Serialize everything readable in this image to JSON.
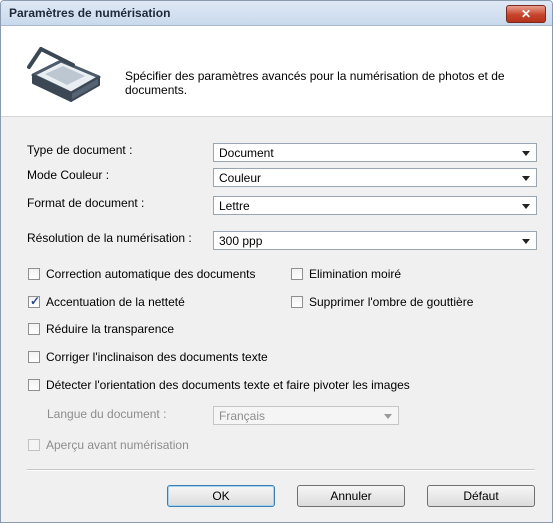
{
  "window": {
    "title": "Paramètres de numérisation",
    "close_label": "✕"
  },
  "header": {
    "description": "Spécifier des paramètres avancés pour la numérisation de photos et de documents.",
    "icon": "scanner-icon"
  },
  "fields": {
    "document_type": {
      "label": "Type de document :",
      "value": "Document"
    },
    "color_mode": {
      "label": "Mode Couleur :",
      "value": "Couleur"
    },
    "document_size": {
      "label": "Format de document :",
      "value": "Lettre"
    },
    "scan_resolution": {
      "label": "Résolution de la numérisation :",
      "value": "300 ppp"
    },
    "document_language": {
      "label": "Langue du document :",
      "value": "Français"
    }
  },
  "options": {
    "auto_correction": {
      "label": "Correction automatique des documents",
      "checked": false
    },
    "moire_removal": {
      "label": "Elimination moiré",
      "checked": false
    },
    "sharpening": {
      "label": "Accentuation de la netteté",
      "checked": true,
      "mark": "✓"
    },
    "gutter_shadow": {
      "label": "Supprimer l'ombre de gouttière",
      "checked": false
    },
    "reduce_show_through": {
      "label": "Réduire la transparence",
      "checked": false
    },
    "skew_correction": {
      "label": "Corriger l'inclinaison des documents texte",
      "checked": false
    },
    "orientation_detect": {
      "label": "Détecter l'orientation des documents texte et faire pivoter les images",
      "checked": false
    },
    "preview_before_scan": {
      "label": "Aperçu avant numérisation",
      "checked": false,
      "enabled": false
    }
  },
  "buttons": {
    "ok": "OK",
    "cancel": "Annuler",
    "default": "Défaut"
  },
  "colors": {
    "titlebar": "#c9d9ec",
    "close": "#c7442b",
    "dialog_bg": "#f0f0f0",
    "disabled_text": "#8d8d8d"
  }
}
